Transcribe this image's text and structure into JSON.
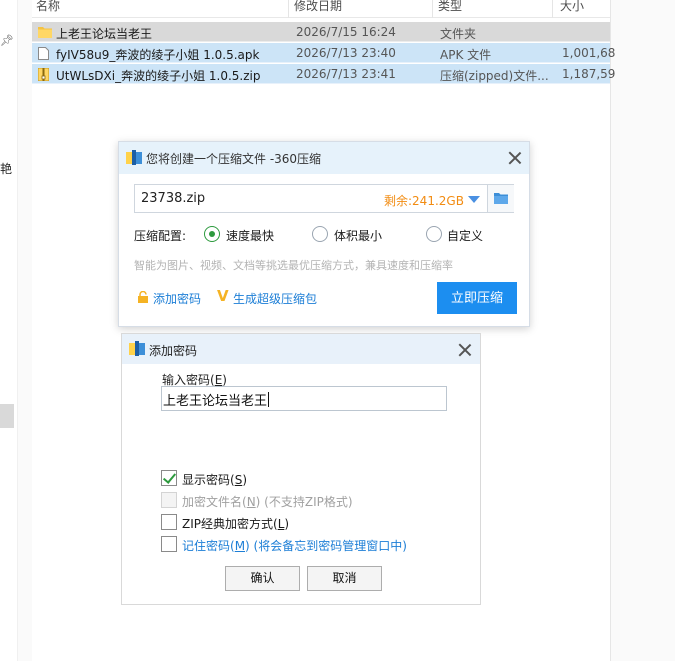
{
  "explorer": {
    "columns": [
      "名称",
      "修改日期",
      "类型",
      "大小"
    ],
    "side_text": "艳",
    "files": [
      {
        "name": "上老王论坛当老王",
        "date": "2026/7/15 16:24",
        "type": "文件夹",
        "size": "",
        "icon": "folder-icon"
      },
      {
        "name": "fyIV58u9_奔波的绫子小姐 1.0.5.apk",
        "date": "2026/7/13 23:40",
        "type": "APK 文件",
        "size": "1,001,68",
        "icon": "file-icon"
      },
      {
        "name": "UtWLsDXi_奔波的绫子小姐 1.0.5.zip",
        "date": "2026/7/13 23:41",
        "type": "压缩(zipped)文件...",
        "size": "1,187,59",
        "icon": "zip-icon"
      }
    ]
  },
  "compress_dialog": {
    "title": "您将创建一个压缩文件 -360压缩",
    "filename": "23738.zip",
    "free_space": "剩余:241.2GB",
    "config_label": "压缩配置:",
    "options": [
      "速度最快",
      "体积最小",
      "自定义"
    ],
    "selected_option": "速度最快",
    "hint": "智能为图片、视频、文档等挑选最优压缩方式，兼具速度和压缩率",
    "add_password": "添加密码",
    "super_pack": "生成超级压缩包",
    "compress_now": "立即压缩"
  },
  "password_dialog": {
    "title": "添加密码",
    "input_label_text": "输入密码(",
    "input_label_key": "E",
    "input_label_end": ")",
    "password_value": "上老王论坛当老王",
    "show_password": {
      "text": "显示密码(",
      "key": "S",
      "end": ")",
      "checked": true
    },
    "encrypt_filename": {
      "text": "加密文件名(",
      "key": "N",
      "end": ") (不支持ZIP格式)",
      "checked": false
    },
    "zip_classic": {
      "text": "ZIP经典加密方式(",
      "key": "L",
      "end": ")",
      "checked": false
    },
    "remember": {
      "text": "记住密码(",
      "key": "M",
      "end": ") (将会备忘到密码管理窗口中)",
      "checked": false
    },
    "ok": "确认",
    "cancel": "取消"
  },
  "colors": {
    "accent": "#1c8ef0",
    "selection": "#cce4f7",
    "radio_on": "#2d9a3e",
    "free_space": "#f28c12"
  }
}
